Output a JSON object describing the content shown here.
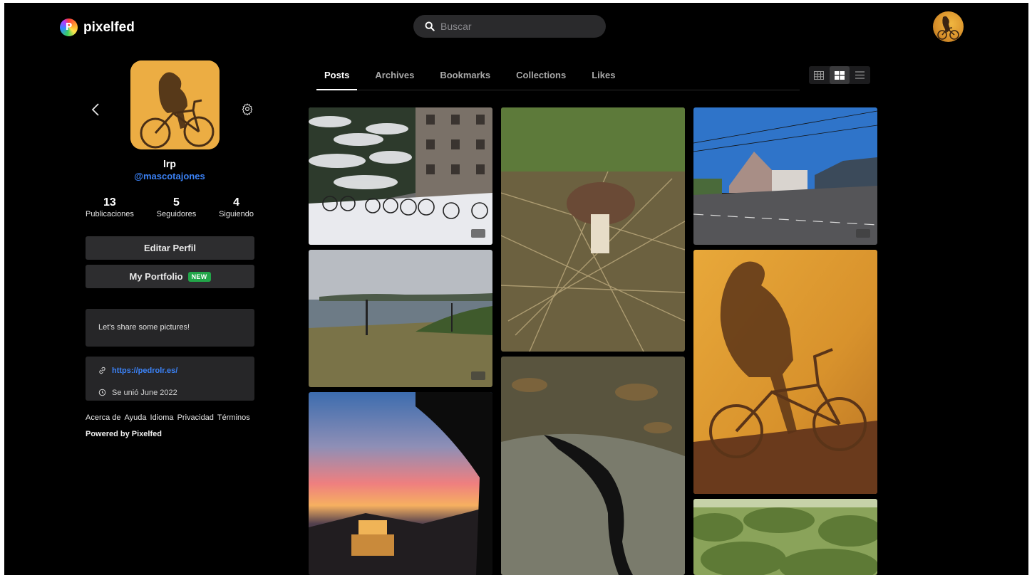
{
  "app": {
    "name": "pixelfed",
    "logo_letter": "P"
  },
  "search": {
    "placeholder": "Buscar"
  },
  "profile": {
    "display_name": "lrp",
    "handle": "@mascotajones",
    "stats": [
      {
        "value": "13",
        "label": "Publicaciones"
      },
      {
        "value": "5",
        "label": "Seguidores"
      },
      {
        "value": "4",
        "label": "Siguiendo"
      }
    ],
    "edit_button": "Editar Perfil",
    "portfolio_button": "My Portfolio",
    "portfolio_badge": "NEW",
    "bio": "Let's share some pictures!",
    "website": "https://pedrolr.es/",
    "joined": "Se unió June 2022"
  },
  "footer": {
    "links": [
      "Acerca de",
      "Ayuda",
      "Idioma",
      "Privacidad",
      "Términos"
    ],
    "powered": "Powered by Pixelfed"
  },
  "tabs": [
    "Posts",
    "Archives",
    "Bookmarks",
    "Collections",
    "Likes"
  ],
  "active_tab": "Posts",
  "layout_options": [
    "grid-icon",
    "masonry-icon",
    "list-icon"
  ],
  "active_layout": "masonry-icon",
  "colors": {
    "background": "#000000",
    "accent": "#3b82f6",
    "new_badge": "#22a649",
    "panel": "#262628"
  }
}
